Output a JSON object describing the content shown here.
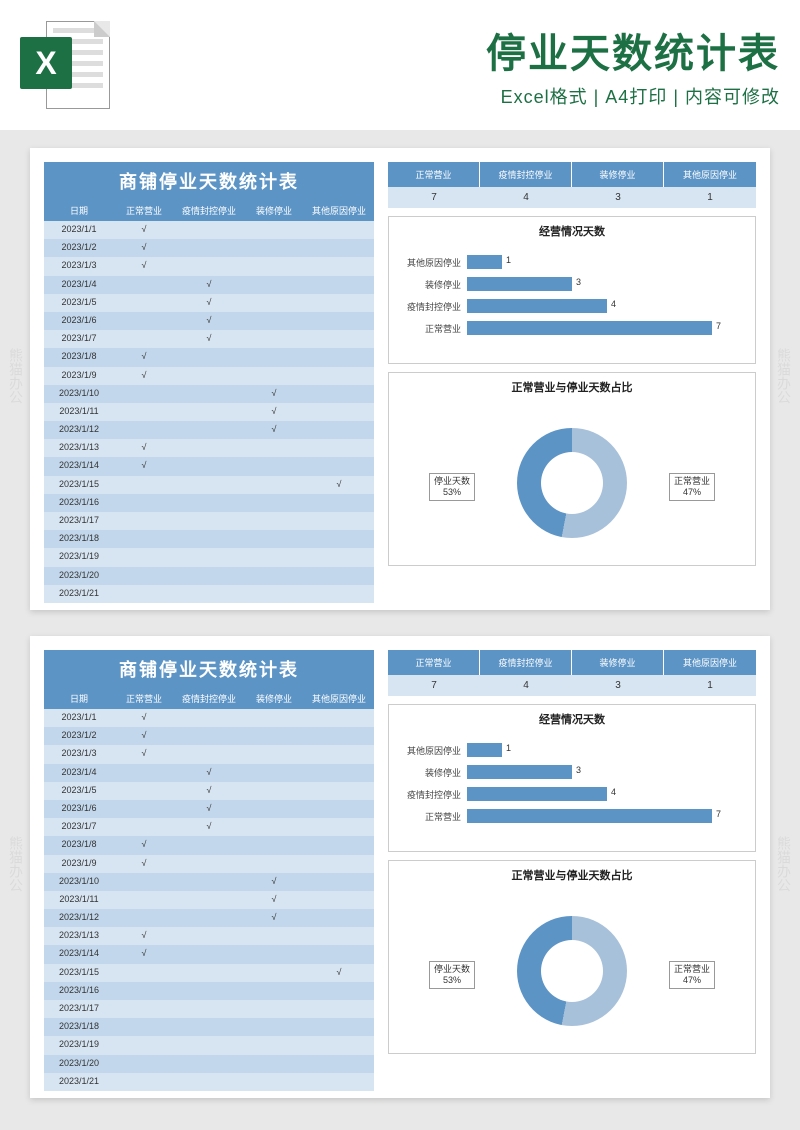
{
  "header": {
    "icon_letter": "X",
    "title": "停业天数统计表",
    "subtitle": "Excel格式 | A4打印 | 内容可修改"
  },
  "watermark": "熊猫办公",
  "template": {
    "title": "商铺停业天数统计表",
    "columns": [
      "日期",
      "正常营业",
      "疫情封控停业",
      "装修停业",
      "其他原因停业"
    ],
    "rows": [
      {
        "date": "2023/1/1",
        "normal": "√",
        "covid": "",
        "reno": "",
        "other": ""
      },
      {
        "date": "2023/1/2",
        "normal": "√",
        "covid": "",
        "reno": "",
        "other": ""
      },
      {
        "date": "2023/1/3",
        "normal": "√",
        "covid": "",
        "reno": "",
        "other": ""
      },
      {
        "date": "2023/1/4",
        "normal": "",
        "covid": "√",
        "reno": "",
        "other": ""
      },
      {
        "date": "2023/1/5",
        "normal": "",
        "covid": "√",
        "reno": "",
        "other": ""
      },
      {
        "date": "2023/1/6",
        "normal": "",
        "covid": "√",
        "reno": "",
        "other": ""
      },
      {
        "date": "2023/1/7",
        "normal": "",
        "covid": "√",
        "reno": "",
        "other": ""
      },
      {
        "date": "2023/1/8",
        "normal": "√",
        "covid": "",
        "reno": "",
        "other": ""
      },
      {
        "date": "2023/1/9",
        "normal": "√",
        "covid": "",
        "reno": "",
        "other": ""
      },
      {
        "date": "2023/1/10",
        "normal": "",
        "covid": "",
        "reno": "√",
        "other": ""
      },
      {
        "date": "2023/1/11",
        "normal": "",
        "covid": "",
        "reno": "√",
        "other": ""
      },
      {
        "date": "2023/1/12",
        "normal": "",
        "covid": "",
        "reno": "√",
        "other": ""
      },
      {
        "date": "2023/1/13",
        "normal": "√",
        "covid": "",
        "reno": "",
        "other": ""
      },
      {
        "date": "2023/1/14",
        "normal": "√",
        "covid": "",
        "reno": "",
        "other": ""
      },
      {
        "date": "2023/1/15",
        "normal": "",
        "covid": "",
        "reno": "",
        "other": "√"
      },
      {
        "date": "2023/1/16",
        "normal": "",
        "covid": "",
        "reno": "",
        "other": ""
      },
      {
        "date": "2023/1/17",
        "normal": "",
        "covid": "",
        "reno": "",
        "other": ""
      },
      {
        "date": "2023/1/18",
        "normal": "",
        "covid": "",
        "reno": "",
        "other": ""
      },
      {
        "date": "2023/1/19",
        "normal": "",
        "covid": "",
        "reno": "",
        "other": ""
      },
      {
        "date": "2023/1/20",
        "normal": "",
        "covid": "",
        "reno": "",
        "other": ""
      },
      {
        "date": "2023/1/21",
        "normal": "",
        "covid": "",
        "reno": "",
        "other": ""
      }
    ],
    "summary": {
      "headers": [
        "正常营业",
        "疫情封控停业",
        "装修停业",
        "其他原因停业"
      ],
      "values": [
        "7",
        "4",
        "3",
        "1"
      ]
    },
    "bar_chart_title": "经营情况天数",
    "donut_chart_title": "正常营业与停业天数占比",
    "donut_labels": {
      "closed": "停业天数",
      "closed_pct": "53%",
      "open": "正常营业",
      "open_pct": "47%"
    }
  },
  "chart_data": [
    {
      "type": "bar",
      "orientation": "horizontal",
      "title": "经营情况天数",
      "categories": [
        "其他原因停业",
        "装修停业",
        "疫情封控停业",
        "正常营业"
      ],
      "values": [
        1,
        3,
        4,
        7
      ],
      "xlim": [
        0,
        8
      ]
    },
    {
      "type": "pie",
      "subtype": "donut",
      "title": "正常营业与停业天数占比",
      "series": [
        {
          "name": "停业天数",
          "value": 53,
          "color": "#a8c1da"
        },
        {
          "name": "正常营业",
          "value": 47,
          "color": "#5c94c6"
        }
      ]
    }
  ]
}
